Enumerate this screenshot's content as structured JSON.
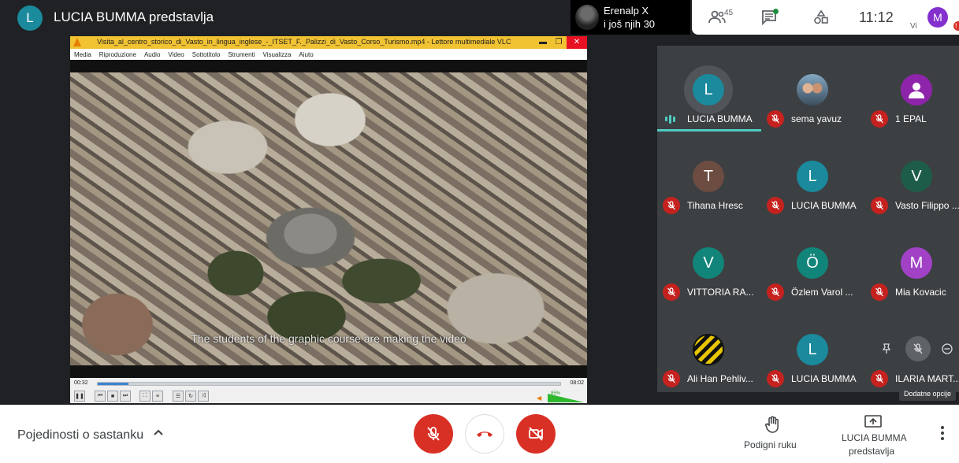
{
  "header": {
    "presenter_initial": "L",
    "presenter_title": "LUCIA BUMMA predstavlja",
    "others_name": "Erenalp X",
    "others_more": "i još njih 30",
    "people_count": "45",
    "clock": "11:12",
    "self_initial": "M",
    "self_label": "Vi",
    "badge": "!"
  },
  "vlc": {
    "title": "Visita_al_centro_storico_di_Vasto_in_lingua_inglese_-_ITSET_F._Palizzi_di_Vasto_Corso_Turismo.mp4 - Lettore multimediale VLC",
    "menu": [
      "Media",
      "Riproduzione",
      "Audio",
      "Video",
      "Sottotitolo",
      "Strumenti",
      "Visualizza",
      "Aiuto"
    ],
    "subtitle": "The students of the graphic course are making the video",
    "time_elapsed": "00:32",
    "time_total": "08:02",
    "progress_fraction": 0.066,
    "volume": "85%"
  },
  "participants": [
    {
      "name": "LUCIA BUMMA",
      "initial": "L",
      "color": "#1a8a9c",
      "muted": false,
      "speaking": true
    },
    {
      "name": "sema yavuz",
      "initial": "",
      "color": "#84a7c3",
      "muted": true,
      "photo": true
    },
    {
      "name": "1 EPAL",
      "initial": "",
      "color": "#8e24aa",
      "muted": true,
      "generic": true
    },
    {
      "name": "Tihana Hresc",
      "initial": "T",
      "color": "#6d4c41",
      "muted": true
    },
    {
      "name": "LUCIA BUMMA",
      "initial": "L",
      "color": "#1a8a9c",
      "muted": true
    },
    {
      "name": "Vasto Filippo ...",
      "initial": "V",
      "color": "#1e5c4a",
      "muted": true
    },
    {
      "name": "VITTORIA RA...",
      "initial": "V",
      "color": "#12857a",
      "muted": true
    },
    {
      "name": "Özlem Varol ...",
      "initial": "Ö",
      "color": "#12857a",
      "muted": true
    },
    {
      "name": "Mia Kovacic",
      "initial": "M",
      "color": "#a142c6",
      "muted": true
    },
    {
      "name": "Ali Han Pehliv...",
      "initial": "",
      "color": "#111111",
      "muted": true,
      "logo": true
    },
    {
      "name": "LUCIA BUMMA",
      "initial": "L",
      "color": "#1a8a9c",
      "muted": true
    },
    {
      "name": "ILARIA MART...",
      "initial": "",
      "color": "#3c4043",
      "muted": true,
      "hovered": true
    }
  ],
  "tooltip": "Dodatne opcije",
  "footer": {
    "meeting_details": "Pojedinosti o sastanku",
    "raise_hand": "Podigni ruku",
    "presenting_line1": "LUCIA BUMMA",
    "presenting_line2": "predstavlja"
  },
  "colors": {
    "red": "#d93025",
    "teal": "#4ecdc4",
    "dark": "#202124"
  }
}
